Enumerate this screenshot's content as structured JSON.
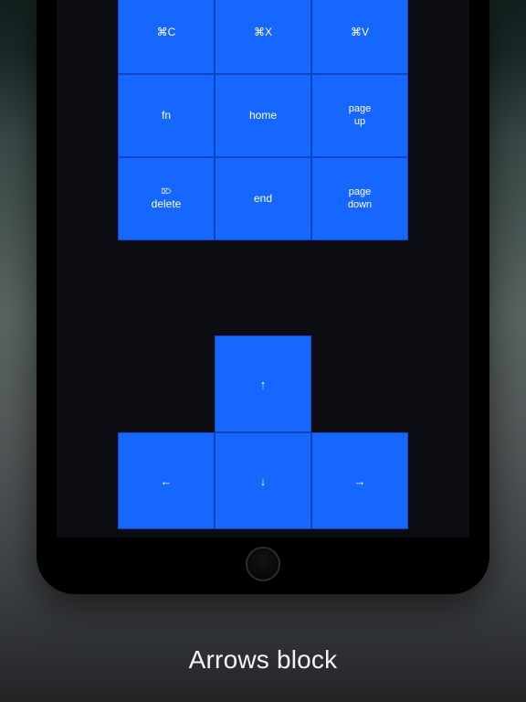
{
  "caption": "Arrows block",
  "keys": {
    "r0c0": "⌘C",
    "r0c1": "⌘X",
    "r0c2": "⌘V",
    "r1c0": "fn",
    "r1c1": "home",
    "r1c2": "page\nup",
    "r2c0_mini": "⌦",
    "r2c0": "delete",
    "r2c1": "end",
    "r2c2": "page\ndown"
  },
  "arrows": {
    "up": "↑",
    "left": "←",
    "down": "↓",
    "right": "→"
  },
  "colors": {
    "key_bg": "#1667ff",
    "key_border": "#0d47c0",
    "screen_bg": "#0c0d12"
  }
}
